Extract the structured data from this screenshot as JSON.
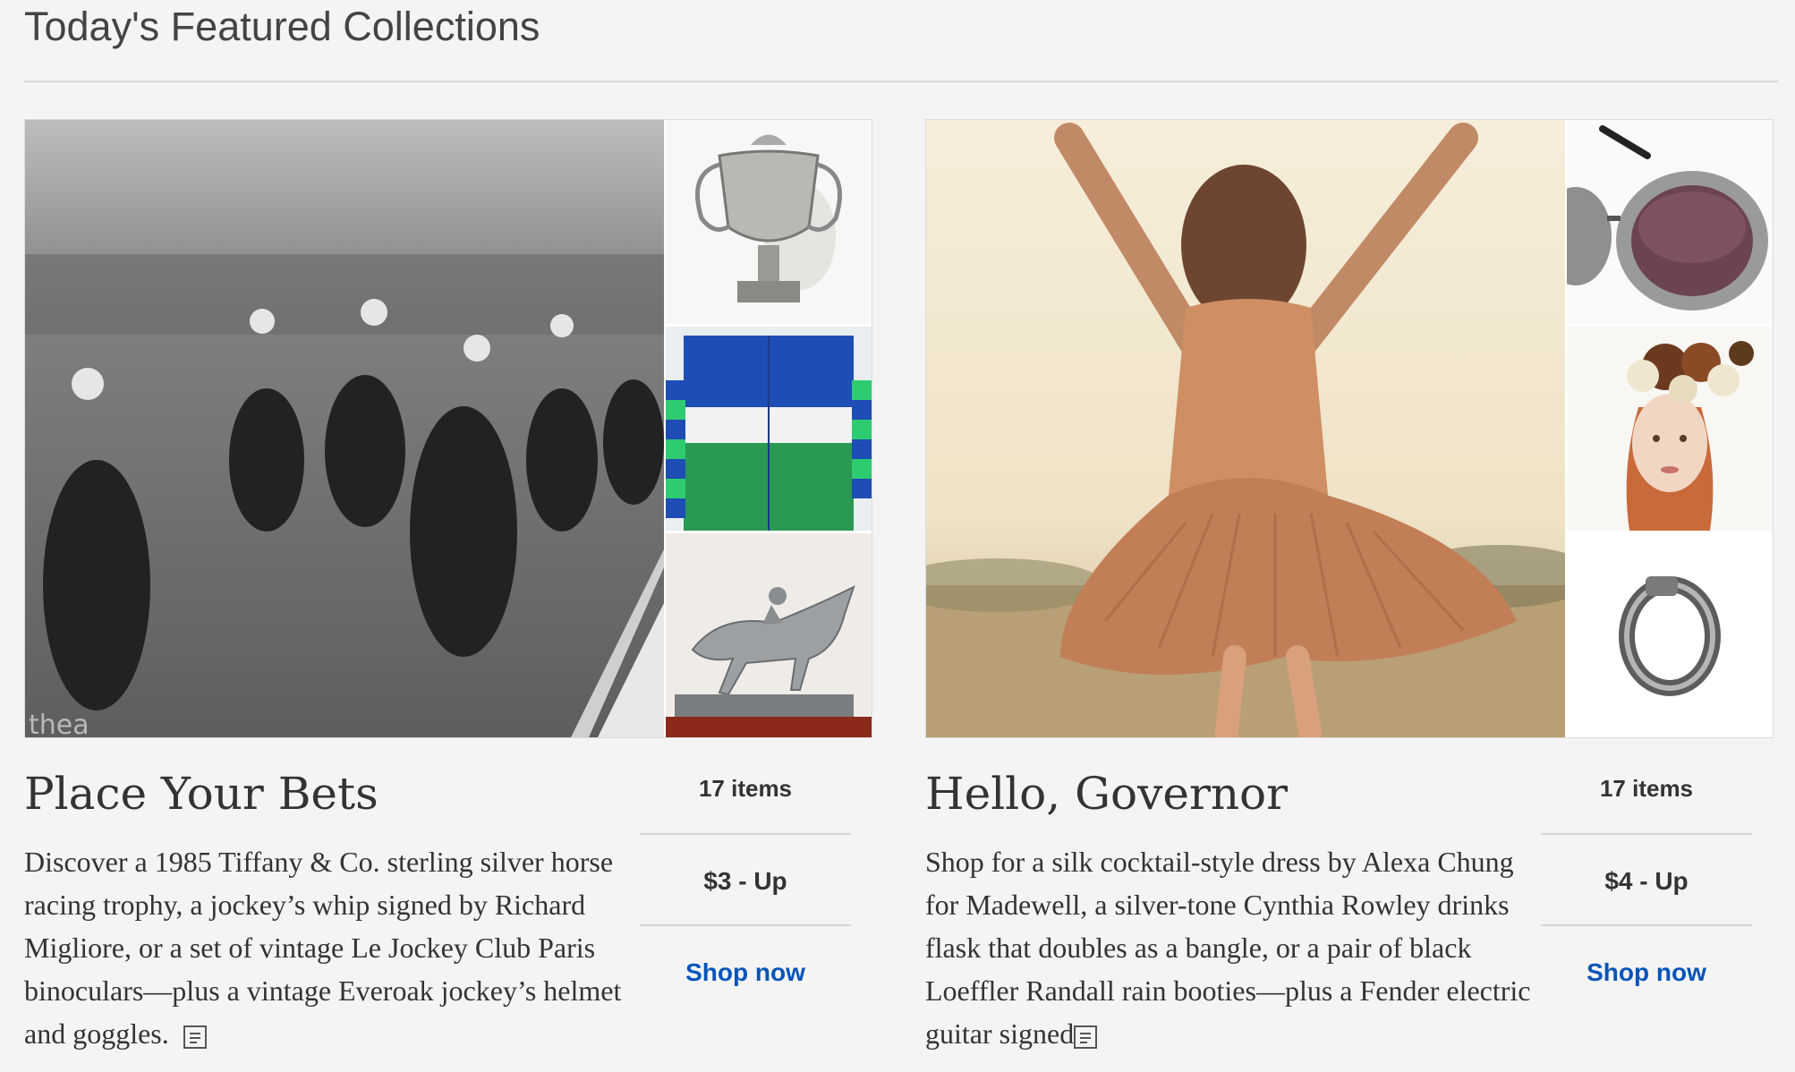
{
  "section": {
    "title": "Today's Featured Collections"
  },
  "collections": [
    {
      "title": "Place Your Bets",
      "description": "Discover a 1985 Tiffany & Co. sterling silver horse racing trophy, a jockey’s whip signed by Richard Migliore, or a set of vintage Le Jockey Club Paris binoculars—plus a vintage Everoak jockey’s helmet and goggles.",
      "items": "17 items",
      "price": "$3 - Up",
      "shop_label": "Shop now",
      "hero_watermark": "thea",
      "images": [
        "horse-race-photo",
        "silver-trophy",
        "jockey-silks-jacket",
        "silver-horse-statue"
      ]
    },
    {
      "title": "Hello, Governor",
      "description": "Shop for a silk cocktail-style dress by Alexa Chung for Madewell, a silver-tone Cynthia Rowley drinks flask that doubles as a bangle, or a pair of black Loeffler Randall rain booties—plus a Fender electric guitar signed",
      "items": "17 items",
      "price": "$4 - Up",
      "shop_label": "Shop now",
      "images": [
        "dancing-woman-photo",
        "glitter-sunglasses",
        "floral-headpiece",
        "flask-bangle"
      ]
    }
  ],
  "colors": {
    "link": "#0654ba",
    "divider": "#d8d8d8",
    "background": "#f4f4f4"
  }
}
